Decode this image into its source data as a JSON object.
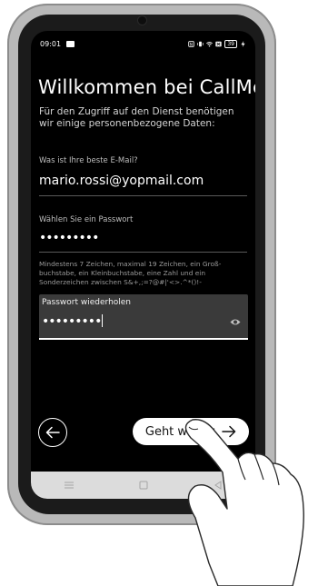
{
  "status_bar": {
    "time": "09:01",
    "battery": "39"
  },
  "header": {
    "title": "Willkommen bei CallMe",
    "subtitle": "Für den Zugriff auf den Dienst benötigen wir einige personenbezogene Daten:"
  },
  "email_field": {
    "label": "Was ist Ihre beste E-Mail?",
    "value": "mario.rossi@yopmail.com"
  },
  "password_field": {
    "label": "Wählen Sie ein Passwort",
    "value": "•••••••••"
  },
  "password_hint": "Mindestens 7 Zeichen, maximal 19 Zeichen, ein Groß­buchstabe, ein Kleinbuchstabe, eine Zahl und ein Sonderzeichen zwischen S&+,;=?@#|'<>.^*()!-",
  "repeat_password_field": {
    "label": "Passwort wiederholen",
    "value": "•••••••••"
  },
  "footer": {
    "next_label": "Geht weiter"
  },
  "icons": {
    "back": "arrow-left-icon",
    "next": "arrow-right-icon",
    "visibility": "eye-icon",
    "nav_recent": "recent-apps-icon",
    "nav_home": "home-icon",
    "nav_back": "nav-back-icon"
  }
}
